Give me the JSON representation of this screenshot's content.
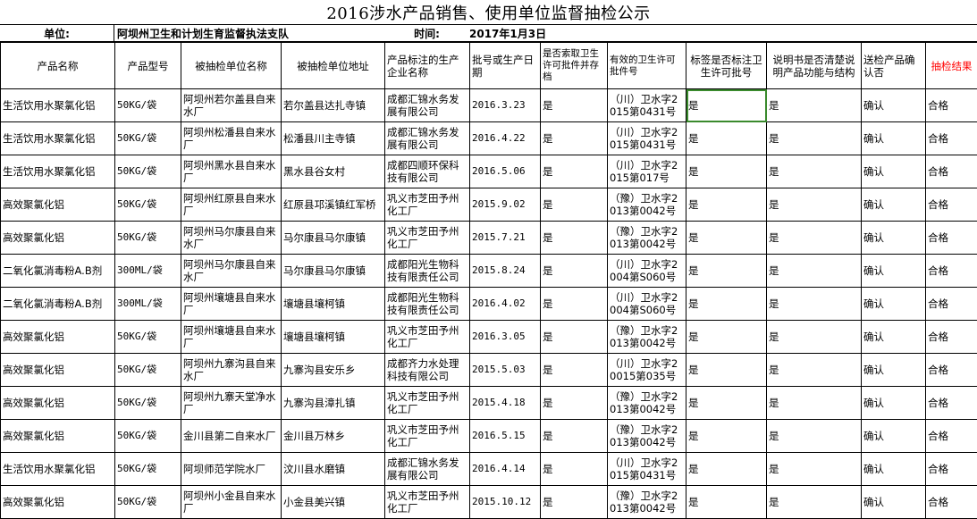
{
  "title": "2016涉水产品销售、使用单位监督抽检公示",
  "unit_label": "单位:",
  "unit_value": "阿坝州卫生和计划生育监督执法支队",
  "time_label": "时间:",
  "time_value": "2017年1月3日",
  "headers": [
    "产品名称",
    "产品型号",
    "被抽检单位名称",
    "被抽检单位地址",
    "产品标注的生产企业名称",
    "批号或生产日期",
    "是否索取卫生许可批件并存档",
    "有效的卫生许可批件号",
    "标签是否标注卫生许可批号",
    "说明书是否清楚说明产品功能与结构",
    "送检产品确认否",
    "抽检结果"
  ],
  "rows": [
    [
      "生活饮用水聚氯化铝",
      "50KG/袋",
      "阿坝州若尔盖县自来水厂",
      "若尔盖县达扎寺镇",
      "成都汇锦水务发展有限公司",
      "2016.3.23",
      "是",
      "（川）卫水字2015第0431号",
      "是",
      "是",
      "确认",
      "合格"
    ],
    [
      "生活饮用水聚氯化铝",
      "50KG/袋",
      "阿坝州松潘县自来水厂",
      "松潘县川主寺镇",
      "成都汇锦水务发展有限公司",
      "2016.4.22",
      "是",
      "（川）卫水字2015第0431号",
      "是",
      "是",
      "确认",
      "合格"
    ],
    [
      "生活饮用水聚氯化铝",
      "50KG/袋",
      "阿坝州黑水县自来水厂",
      "黑水县谷女村",
      "成都四顺环保科技有限公司",
      "2016.5.06",
      "是",
      "（川）卫水字2015第017号",
      "是",
      "是",
      "确认",
      "合格"
    ],
    [
      "高效聚氯化铝",
      "50KG/袋",
      "阿坝州红原县自来水厂",
      "红原县邛溪镇红军桥",
      "巩义市芝田予州化工厂",
      "2015.9.02",
      "是",
      "（豫）卫水字2013第0042号",
      "是",
      "是",
      "确认",
      "合格"
    ],
    [
      "高效聚氯化铝",
      "50KG/袋",
      "阿坝州马尔康县自来水厂",
      "马尔康县马尔康镇",
      "巩义市芝田予州化工厂",
      "2015.7.21",
      "是",
      "（豫）卫水字2013第0042号",
      "是",
      "是",
      "确认",
      "合格"
    ],
    [
      "二氧化氯消毒粉A.B剂",
      "300ML/袋",
      "阿坝州马尔康县自来水厂",
      "马尔康县马尔康镇",
      "成都阳光生物科技有限责任公司",
      "2015.8.24",
      "是",
      "（川）卫水字2004第S060号",
      "是",
      "是",
      "确认",
      "合格"
    ],
    [
      "二氧化氯消毒粉A.B剂",
      "300ML/袋",
      "阿坝州壤塘县自来水厂",
      "壤塘县壤柯镇",
      "成都阳光生物科技有限责任公司",
      "2016.4.02",
      "是",
      "（川）卫水字2004第S060号",
      "是",
      "是",
      "确认",
      "合格"
    ],
    [
      "高效聚氯化铝",
      "50KG/袋",
      "阿坝州壤塘县自来水厂",
      "壤塘县壤柯镇",
      "巩义市芝田予州化工厂",
      "2016.3.05",
      "是",
      "（豫）卫水字2013第0042号",
      "是",
      "是",
      "确认",
      "合格"
    ],
    [
      "高效聚氯化铝",
      "50KG/袋",
      "阿坝州九寨沟县自来水厂",
      "九寨沟县安乐乡",
      "成都齐力水处理科技有限公司",
      "2015.5.03",
      "是",
      "（川）卫水字20015第035号",
      "是",
      "是",
      "确认",
      "合格"
    ],
    [
      "高效聚氯化铝",
      "50KG/袋",
      "阿坝州九寨天堂净水厂",
      "九寨沟县漳扎镇",
      "巩义市芝田予州化工厂",
      "2015.4.18",
      "是",
      "（豫）卫水字2013第0042号",
      "是",
      "是",
      "确认",
      "合格"
    ],
    [
      "高效聚氯化铝",
      "50KG/袋",
      "金川县第二自来水厂",
      "金川县万林乡",
      "巩义市芝田予州化工厂",
      "2016.5.15",
      "是",
      "（豫）卫水字2013第0042号",
      "是",
      "是",
      "确认",
      "合格"
    ],
    [
      "生活饮用水聚氯化铝",
      "50KG/袋",
      "阿坝师范学院水厂",
      "汶川县水磨镇",
      "成都汇锦水务发展有限公司",
      "2016.4.14",
      "是",
      "（川）卫水字2015第0431号",
      "是",
      "是",
      "确认",
      "合格"
    ],
    [
      "高效聚氯化铝",
      "50KG/袋",
      "阿坝州小金县自来水厂",
      "小金县美兴镇",
      "巩义市芝田予州化工厂",
      "2015.10.12",
      "是",
      "（豫）卫水字2013第0042号",
      "是",
      "是",
      "确认",
      "合格"
    ]
  ],
  "colors": {
    "result_header": "#ff0000",
    "selection_border": "#3a8a2d"
  }
}
